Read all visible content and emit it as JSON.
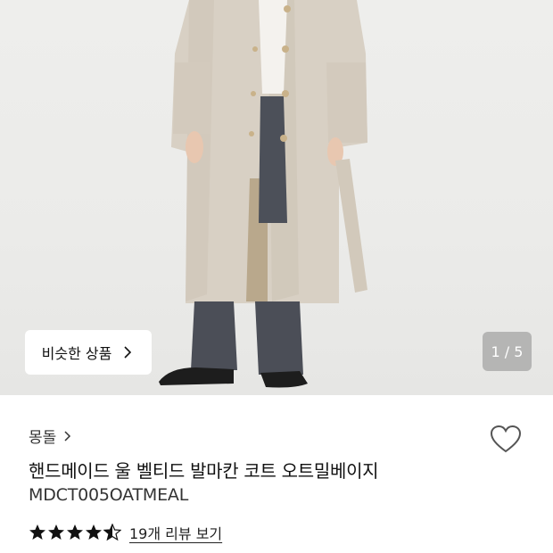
{
  "product": {
    "similar_label": "비슷한 상품",
    "image_counter": "1 / 5",
    "brand": "몽돌",
    "title": "핸드메이드 울 벨티드 발마칸 코트 오트밀베이지",
    "code": "MDCT005OATMEAL",
    "rating_value": 4.5,
    "review_link": "19개 리뷰 보기"
  },
  "colors": {
    "star": "#111111",
    "coat": "#d7cfc3",
    "pants": "#4a4d55"
  },
  "icons": {
    "heart": "heart-outline-icon",
    "chevron": "chevron-right-icon",
    "star": "star-icon"
  }
}
